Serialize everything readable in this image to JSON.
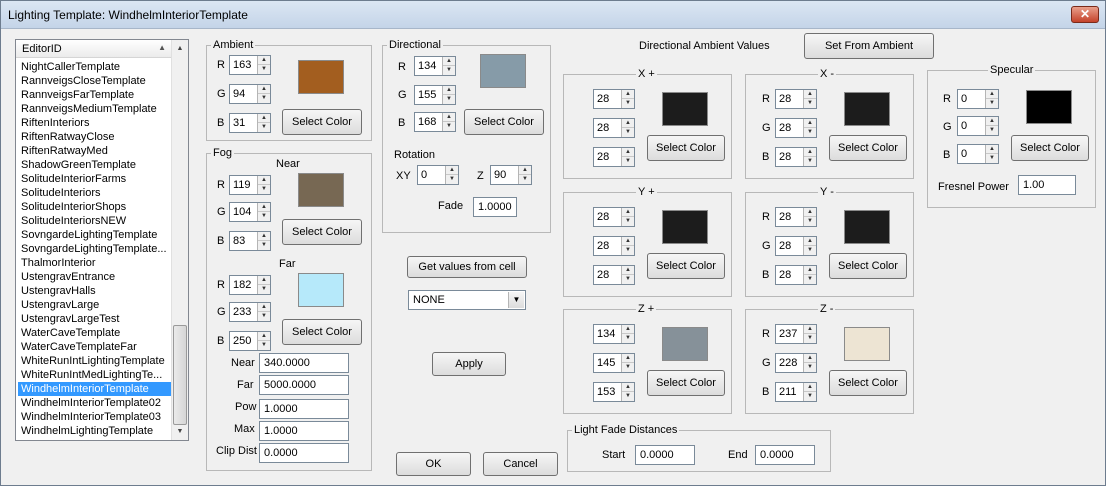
{
  "window": {
    "title": "Lighting Template: WindhelmInteriorTemplate",
    "close_glyph": "✕"
  },
  "list": {
    "header": "EditorID",
    "items": [
      "NightCallerTemplate",
      "RannveigsCloseTemplate",
      "RannveigsFarTemplate",
      "RannveigsMediumTemplate",
      "RiftenInteriors",
      "RiftenRatwayClose",
      "RiftenRatwayMed",
      "ShadowGreenTemplate",
      "SolitudeInteriorFarms",
      "SolitudeInteriors",
      "SolitudeInteriorShops",
      "SolitudeInteriorsNEW",
      "SovngardeLightingTemplate",
      "SovngardeLightingTemplate...",
      "ThalmorInterior",
      "UstengravEntrance",
      "UstengravHalls",
      "UstengravLarge",
      "UstengravLargeTest",
      "WaterCaveTemplate",
      "WaterCaveTemplateFar",
      "WhiteRunIntLightingTemplate",
      "WhiteRunIntMedLightingTe...",
      "WindhelmInteriorTemplate",
      "WindhelmInteriorTemplate02",
      "WindhelmInteriorTemplate03",
      "WindhelmLightingTemplate"
    ],
    "selected_index": 23
  },
  "ambient": {
    "legend": "Ambient",
    "r": "163",
    "g": "94",
    "b": "31",
    "color": "#a35e1f",
    "select_label": "Select Color"
  },
  "labels": {
    "r": "R",
    "g": "G",
    "b": "B"
  },
  "fog": {
    "legend": "Fog",
    "near_label": "Near",
    "far_label": "Far",
    "near": {
      "r": "119",
      "g": "104",
      "b": "83",
      "color": "#776853"
    },
    "far": {
      "r": "182",
      "g": "233",
      "b": "250",
      "color": "#b6e9fa"
    },
    "select_label": "Select Color",
    "fields": {
      "near": "Near",
      "far": "Far",
      "pow": "Pow",
      "max": "Max",
      "clip": "Clip Dist"
    },
    "values": {
      "near": "340.0000",
      "far": "5000.0000",
      "pow": "1.0000",
      "max": "1.0000",
      "clip": "0.0000"
    }
  },
  "directional": {
    "legend": "Directional",
    "r": "134",
    "g": "155",
    "b": "168",
    "color": "#869ba8",
    "select_label": "Select Color",
    "rotation_label": "Rotation",
    "xy_label": "XY",
    "xy": "0",
    "z_label": "Z",
    "z": "90",
    "fade_label": "Fade",
    "fade": "1.0000"
  },
  "cell": {
    "get_label": "Get values from cell",
    "dropdown": "NONE",
    "apply_label": "Apply"
  },
  "dav": {
    "title": "Directional Ambient Values",
    "set_from_ambient": "Set From Ambient",
    "xp": {
      "legend": "X +",
      "r": "28",
      "g": "28",
      "b": "28",
      "color": "#1c1c1c"
    },
    "xm": {
      "legend": "X -",
      "r": "28",
      "g": "28",
      "b": "28",
      "color": "#1c1c1c"
    },
    "yp": {
      "legend": "Y +",
      "r": "28",
      "g": "28",
      "b": "28",
      "color": "#1c1c1c"
    },
    "ym": {
      "legend": "Y -",
      "r": "28",
      "g": "28",
      "b": "28",
      "color": "#1c1c1c"
    },
    "zp": {
      "legend": "Z +",
      "r": "134",
      "g": "145",
      "b": "153",
      "color": "#869199"
    },
    "zm": {
      "legend": "Z -",
      "r": "237",
      "g": "228",
      "b": "211",
      "color": "#ede4d3"
    },
    "select_label": "Select Color"
  },
  "specular": {
    "legend": "Specular",
    "r": "0",
    "g": "0",
    "b": "0",
    "color": "#000000",
    "select_label": "Select Color",
    "fresnel_label": "Fresnel Power",
    "fresnel": "1.00"
  },
  "lfd": {
    "legend": "Light Fade Distances",
    "start_label": "Start",
    "start": "0.0000",
    "end_label": "End",
    "end": "0.0000"
  },
  "footer": {
    "ok": "OK",
    "cancel": "Cancel"
  }
}
